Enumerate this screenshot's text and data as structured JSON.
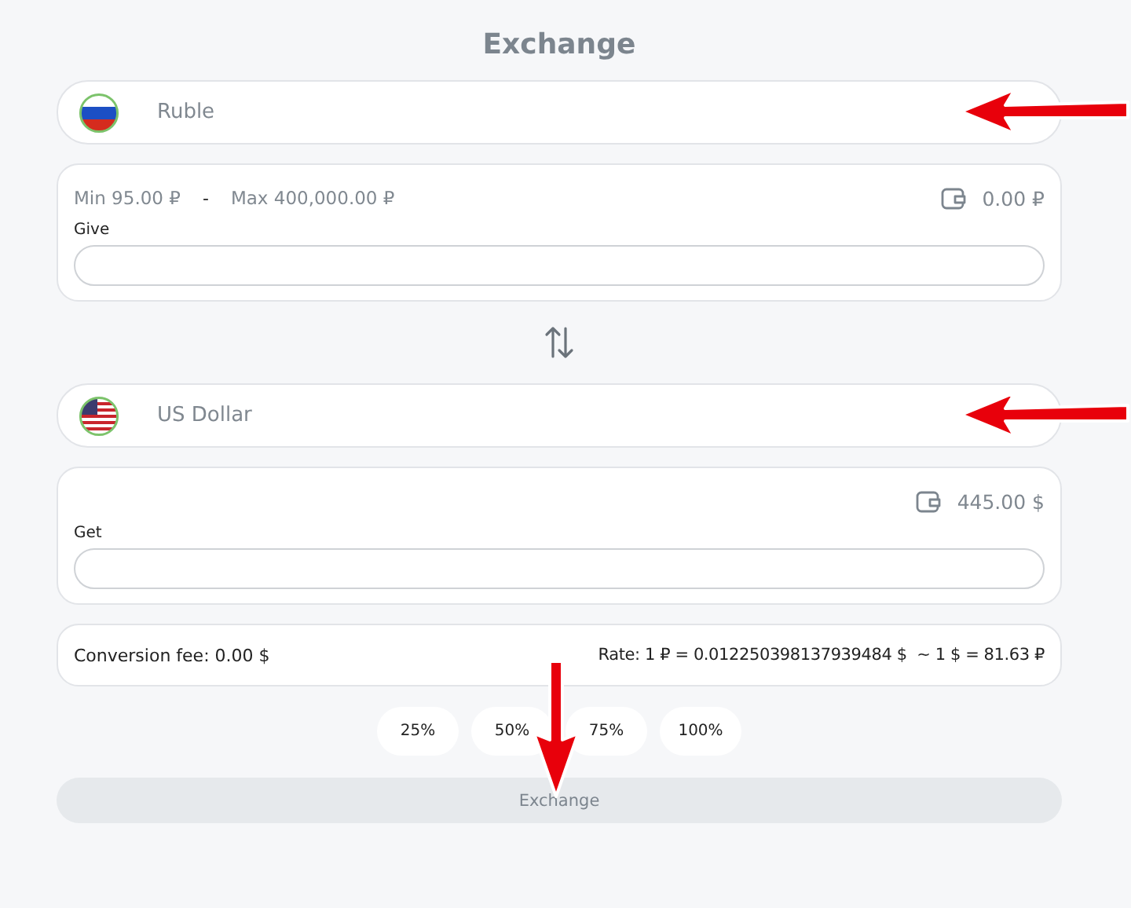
{
  "title": "Exchange",
  "give": {
    "currency": {
      "name": "Ruble",
      "kind": "ru",
      "annotated": true
    },
    "limits": {
      "min": "Min 95.00 ₽",
      "separator": "-",
      "max": "Max 400,000.00 ₽"
    },
    "balance": "0.00 ₽",
    "label": "Give"
  },
  "get": {
    "currency": {
      "name": "US Dollar",
      "kind": "us",
      "annotated": true
    },
    "balance": "445.00 $",
    "label": "Get"
  },
  "fee": "Conversion fee: 0.00 $",
  "rate": "Rate: 1 ₽ = 0.012250398137939484 $  ~ 1 $ = 81.63 ₽",
  "percents": [
    "25%",
    "50%",
    "75%",
    "100%"
  ],
  "submit": {
    "label": "Exchange",
    "disabled": true,
    "annotated": true
  }
}
